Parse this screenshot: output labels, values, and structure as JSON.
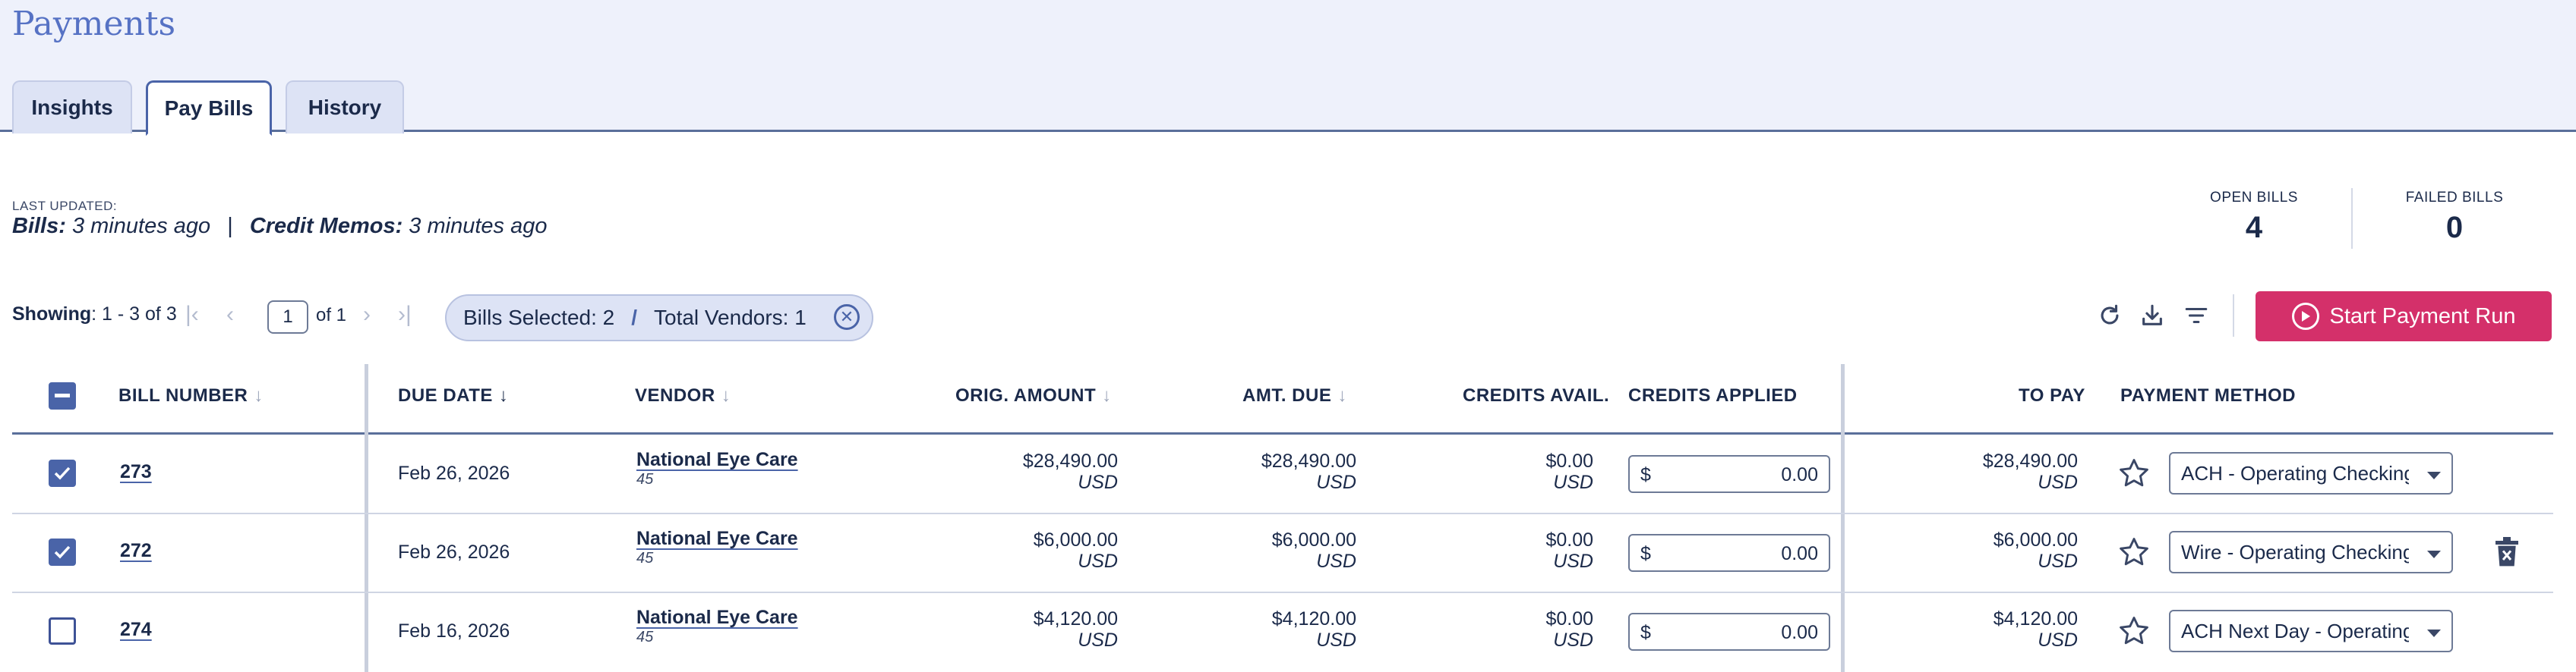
{
  "page": {
    "title": "Payments"
  },
  "tabs": [
    {
      "label": "Insights"
    },
    {
      "label": "Pay Bills"
    },
    {
      "label": "History"
    }
  ],
  "last_updated": {
    "label": "LAST UPDATED:",
    "bills_label": "Bills:",
    "bills_value": "3 minutes ago",
    "separator": "|",
    "credit_label": "Credit Memos:",
    "credit_value": "3 minutes ago"
  },
  "counters": {
    "open_bills": {
      "label": "OPEN BILLS",
      "value": "4"
    },
    "failed_bills": {
      "label": "FAILED BILLS",
      "value": "0"
    }
  },
  "pagination": {
    "showing_label": "Showing",
    "showing_value": ": 1 - 3 of 3",
    "current_page": "1",
    "of_label": "of 1"
  },
  "selection_chip": {
    "bills_selected": "Bills Selected: 2",
    "separator": "/",
    "total_vendors": "Total Vendors: 1"
  },
  "toolbar": {
    "start_payment_run": "Start Payment Run",
    "accent_color": "#d4306a"
  },
  "table": {
    "headers": {
      "bill_number": "BILL NUMBER",
      "due_date": "DUE DATE",
      "vendor": "VENDOR",
      "orig_amount": "ORIG. AMOUNT",
      "amt_due": "AMT. DUE",
      "credits_avail": "CREDITS AVAIL.",
      "credits_applied": "CREDITS APPLIED",
      "to_pay": "TO PAY",
      "payment_method": "PAYMENT METHOD"
    },
    "rows": [
      {
        "checked": true,
        "bill_number": "273",
        "due_date": "Feb 26, 2026",
        "vendor": "National Eye Care",
        "vendor_sub": "45",
        "orig_amount": "$28,490.00",
        "orig_currency": "USD",
        "amt_due": "$28,490.00",
        "amt_currency": "USD",
        "credits_avail": "$0.00",
        "credits_currency": "USD",
        "credits_applied_prefix": "$",
        "credits_applied": "0.00",
        "to_pay": "$28,490.00",
        "to_pay_currency": "USD",
        "payment_method": "ACH - Operating Checking",
        "has_delete": false
      },
      {
        "checked": true,
        "bill_number": "272",
        "due_date": "Feb 26, 2026",
        "vendor": "National Eye Care",
        "vendor_sub": "45",
        "orig_amount": "$6,000.00",
        "orig_currency": "USD",
        "amt_due": "$6,000.00",
        "amt_currency": "USD",
        "credits_avail": "$0.00",
        "credits_currency": "USD",
        "credits_applied_prefix": "$",
        "credits_applied": "0.00",
        "to_pay": "$6,000.00",
        "to_pay_currency": "USD",
        "payment_method": "Wire - Operating Checking",
        "has_delete": true
      },
      {
        "checked": false,
        "bill_number": "274",
        "due_date": "Feb 16, 2026",
        "vendor": "National Eye Care",
        "vendor_sub": "45",
        "orig_amount": "$4,120.00",
        "orig_currency": "USD",
        "amt_due": "$4,120.00",
        "amt_currency": "USD",
        "credits_avail": "$0.00",
        "credits_currency": "USD",
        "credits_applied_prefix": "$",
        "credits_applied": "0.00",
        "to_pay": "$4,120.00",
        "to_pay_currency": "USD",
        "payment_method": "ACH Next Day - Operating",
        "has_delete": false
      }
    ]
  }
}
